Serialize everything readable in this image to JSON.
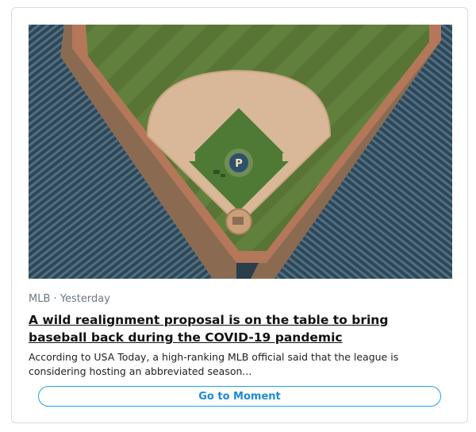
{
  "card": {
    "source": "MLB",
    "separator": "·",
    "time": "Yesterday",
    "headline": "A wild realignment proposal is on the table to bring baseball back during the COVID-19 pandemic",
    "summary": "According to USA Today, a high-ranking MLB official said that the league is considering hosting an abbreviated season...",
    "button_label": "Go to Moment",
    "mound_logo": "P"
  },
  "colors": {
    "border": "#d6dce1",
    "meta_text": "#6a7784",
    "button_accent": "#1da1f2",
    "grass": "#5d7a3a",
    "dirt": "#b9815c",
    "infield_sand": "#d9bb9d",
    "seats": "#3a5566"
  }
}
